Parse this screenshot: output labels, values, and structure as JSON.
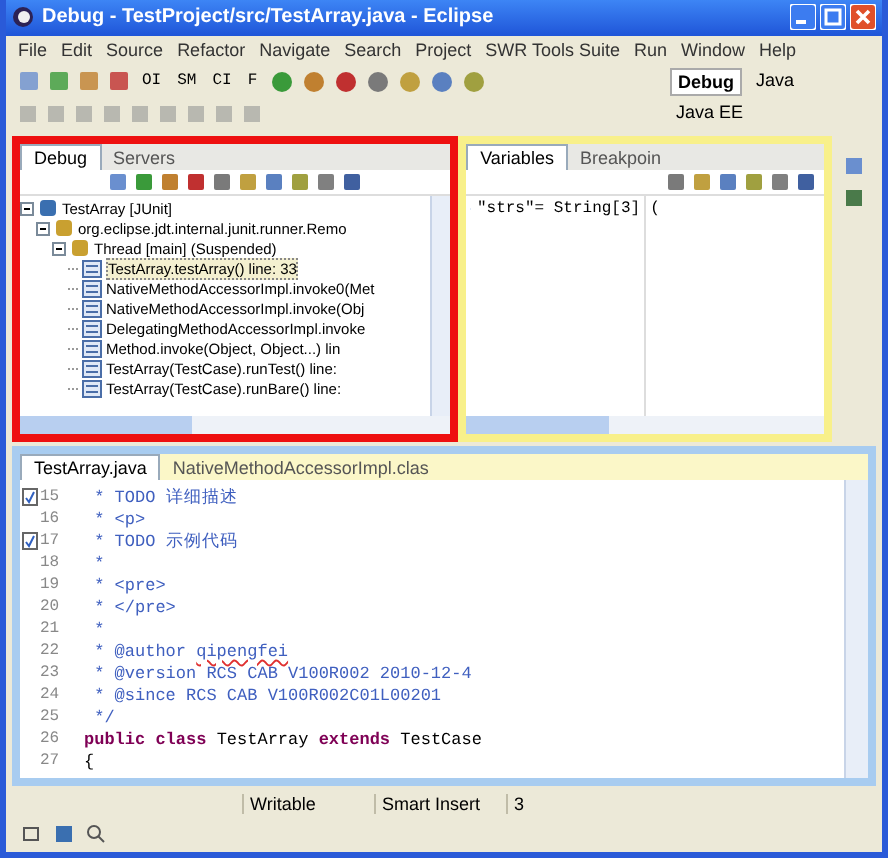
{
  "window": {
    "title": "Debug - TestProject/src/TestArray.java - Eclipse"
  },
  "menu": [
    "File",
    "Edit",
    "Source",
    "Refactor",
    "Navigate",
    "Search",
    "Project",
    "SWR Tools Suite",
    "Run",
    "Window",
    "Help"
  ],
  "toolbar": {
    "text_buttons": [
      "OI",
      "SM",
      "CI",
      "F"
    ]
  },
  "perspectives": [
    {
      "label": "Debug",
      "selected": true
    },
    {
      "label": "Java",
      "selected": false
    },
    {
      "label": "Java EE",
      "selected": false
    }
  ],
  "debug_view": {
    "tabs": [
      {
        "label": "Debug",
        "selected": true
      },
      {
        "label": "Servers",
        "selected": false
      }
    ],
    "tree": [
      {
        "label": "TestArray [JUnit]",
        "expanded": true,
        "children": [
          {
            "label": "org.eclipse.jdt.internal.junit.runner.Remo",
            "expanded": true,
            "children": [
              {
                "label": "Thread [main] (Suspended)",
                "expanded": true,
                "children": [
                  {
                    "label": "TestArray.testArray() line: 33",
                    "selected": true
                  },
                  {
                    "label": "NativeMethodAccessorImpl.invoke0(Met",
                    "selected": false
                  },
                  {
                    "label": "NativeMethodAccessorImpl.invoke(Obj",
                    "selected": false
                  },
                  {
                    "label": "DelegatingMethodAccessorImpl.invoke",
                    "selected": false
                  },
                  {
                    "label": "Method.invoke(Object, Object...) lin",
                    "selected": false
                  },
                  {
                    "label": "TestArray(TestCase).runTest() line:",
                    "selected": false
                  },
                  {
                    "label": "TestArray(TestCase).runBare() line:",
                    "selected": false
                  }
                ]
              }
            ]
          }
        ]
      }
    ]
  },
  "variables_view": {
    "tabs": [
      {
        "label": "Variables",
        "selected": true
      },
      {
        "label": "Breakpoin",
        "selected": false
      }
    ],
    "rows": [
      {
        "name": "\"strs\"= String[3]",
        "value": "("
      }
    ]
  },
  "editor": {
    "tabs": [
      {
        "label": "TestArray.java",
        "selected": true
      },
      {
        "label": "NativeMethodAccessorImpl.clas",
        "selected": false
      }
    ],
    "lines": [
      {
        "number": "15",
        "marker": true,
        "segments": [
          {
            "kind": "comment",
            "text": " * TODO 详细描述"
          }
        ]
      },
      {
        "number": "16",
        "marker": false,
        "segments": [
          {
            "kind": "comment",
            "text": " * <p>"
          }
        ]
      },
      {
        "number": "17",
        "marker": true,
        "segments": [
          {
            "kind": "comment",
            "text": " * TODO 示例代码"
          }
        ]
      },
      {
        "number": "18",
        "marker": false,
        "segments": [
          {
            "kind": "comment",
            "text": " *"
          }
        ]
      },
      {
        "number": "19",
        "marker": false,
        "segments": [
          {
            "kind": "comment",
            "text": " * <pre>"
          }
        ]
      },
      {
        "number": "20",
        "marker": false,
        "segments": [
          {
            "kind": "comment",
            "text": " * </pre>"
          }
        ]
      },
      {
        "number": "21",
        "marker": false,
        "segments": [
          {
            "kind": "comment",
            "text": " *"
          }
        ]
      },
      {
        "number": "22",
        "marker": false,
        "segments": [
          {
            "kind": "comment",
            "text": " * @author "
          },
          {
            "kind": "misspelled",
            "text": "qipengfei"
          }
        ]
      },
      {
        "number": "23",
        "marker": false,
        "segments": [
          {
            "kind": "comment",
            "text": " * @version RCS CAB V100R002 2010-12-4"
          }
        ]
      },
      {
        "number": "24",
        "marker": false,
        "segments": [
          {
            "kind": "comment",
            "text": " * @since RCS CAB V100R002C01L00201"
          }
        ]
      },
      {
        "number": "25",
        "marker": false,
        "segments": [
          {
            "kind": "comment",
            "text": " */"
          }
        ]
      },
      {
        "number": "26",
        "marker": false,
        "segments": [
          {
            "kind": "keyword",
            "text": "public class "
          },
          {
            "kind": "plain",
            "text": "TestArray "
          },
          {
            "kind": "keyword",
            "text": "extends "
          },
          {
            "kind": "plain",
            "text": "TestCase"
          }
        ]
      },
      {
        "number": "27",
        "marker": false,
        "segments": [
          {
            "kind": "plain",
            "text": "{"
          }
        ]
      }
    ]
  },
  "status_bar": [
    "Writable",
    "Smart Insert",
    "3"
  ]
}
